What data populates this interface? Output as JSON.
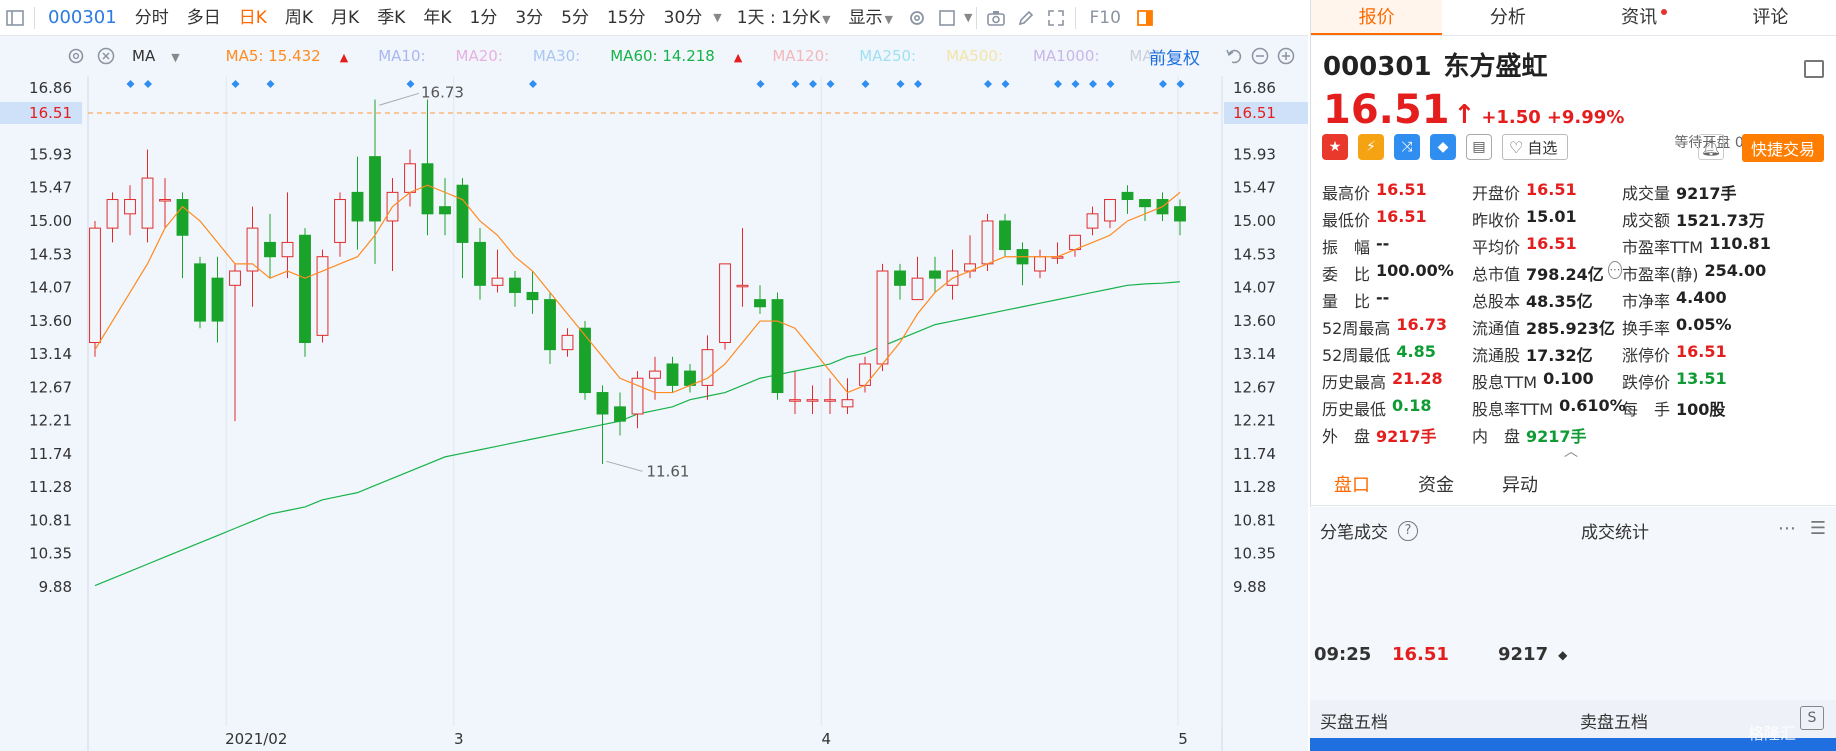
{
  "toolbar": {
    "code": "000301",
    "items": [
      "分时",
      "多日",
      "日K",
      "周K",
      "月K",
      "季K",
      "年K",
      "1分",
      "3分",
      "5分",
      "15分",
      "30分"
    ],
    "active": "日K",
    "period": "1天 : 1分K",
    "display": "显示",
    "f10": "F10"
  },
  "ma_bar": {
    "indicator": "MA",
    "items": [
      {
        "label": "MA5: 15.432",
        "color": "#ff8a1f",
        "arrow": "▲",
        "faded": false
      },
      {
        "label": "MA10:",
        "color": "#aab6f0",
        "faded": true
      },
      {
        "label": "MA20:",
        "color": "#e8b0e0",
        "faded": true
      },
      {
        "label": "MA30:",
        "color": "#a9c7f2",
        "faded": true
      },
      {
        "label": "MA60: 14.218",
        "color": "#17b24a",
        "arrow": "▲",
        "faded": false
      },
      {
        "label": "MA120:",
        "color": "#f4b6bd",
        "faded": true
      },
      {
        "label": "MA250:",
        "color": "#9fe0f4",
        "faded": true
      },
      {
        "label": "MA500:",
        "color": "#f3e4a7",
        "faded": true
      },
      {
        "label": "MA1000:",
        "color": "#c9b6e8",
        "faded": true
      },
      {
        "label": "MA1:",
        "color": "#c9d0dc",
        "faded": true
      }
    ],
    "restore": "前复权"
  },
  "chart_data": {
    "type": "candlestick",
    "y_ticks": [
      "16.86",
      "16.51",
      "15.93",
      "15.47",
      "15.00",
      "14.53",
      "14.07",
      "13.60",
      "13.14",
      "12.67",
      "12.21",
      "11.74",
      "11.28",
      "10.81",
      "10.35",
      "9.88"
    ],
    "x_ticks": [
      "2021/02",
      "3",
      "4",
      "5"
    ],
    "current_price": "16.51",
    "high_label": "16.73",
    "low_label": "11.61",
    "colors": {
      "up": "#e12b2b",
      "down": "#1aa32a",
      "ma5": "#ff8a1f",
      "ma60": "#17b24a",
      "current": "#ff9a3c"
    },
    "candles": [
      [
        13.3,
        14.9,
        13.1,
        15.0
      ],
      [
        14.9,
        15.3,
        14.7,
        15.4
      ],
      [
        15.1,
        15.3,
        14.8,
        15.5
      ],
      [
        14.9,
        15.6,
        14.7,
        16.0
      ],
      [
        15.3,
        15.3,
        14.9,
        15.6
      ],
      [
        15.3,
        14.8,
        14.2,
        15.4
      ],
      [
        14.4,
        13.6,
        13.5,
        14.5
      ],
      [
        14.2,
        13.6,
        13.3,
        14.5
      ],
      [
        14.1,
        14.3,
        12.2,
        14.4
      ],
      [
        14.3,
        14.9,
        13.8,
        15.2
      ],
      [
        14.7,
        14.5,
        14.2,
        15.1
      ],
      [
        14.5,
        14.7,
        14.2,
        15.4
      ],
      [
        14.8,
        13.3,
        13.1,
        14.9
      ],
      [
        13.4,
        14.5,
        13.3,
        14.6
      ],
      [
        14.7,
        15.3,
        14.5,
        15.4
      ],
      [
        15.4,
        15.0,
        14.6,
        15.9
      ],
      [
        15.9,
        15.0,
        14.4,
        16.7
      ],
      [
        15.0,
        15.4,
        14.3,
        15.6
      ],
      [
        15.4,
        15.8,
        15.2,
        16.0
      ],
      [
        15.8,
        15.1,
        14.8,
        16.7
      ],
      [
        15.2,
        15.1,
        14.8,
        15.6
      ],
      [
        15.5,
        14.7,
        14.2,
        15.6
      ],
      [
        14.7,
        14.1,
        13.9,
        14.9
      ],
      [
        14.1,
        14.2,
        14.0,
        14.6
      ],
      [
        14.2,
        14.0,
        13.8,
        14.3
      ],
      [
        14.0,
        13.9,
        13.7,
        14.3
      ],
      [
        13.9,
        13.2,
        13.0,
        14.0
      ],
      [
        13.2,
        13.4,
        13.1,
        13.5
      ],
      [
        13.5,
        12.6,
        12.5,
        13.6
      ],
      [
        12.6,
        12.3,
        11.6,
        12.7
      ],
      [
        12.4,
        12.2,
        12.0,
        12.6
      ],
      [
        12.3,
        12.8,
        12.1,
        12.9
      ],
      [
        12.8,
        12.9,
        12.5,
        13.1
      ],
      [
        13.0,
        12.7,
        12.6,
        13.1
      ],
      [
        12.9,
        12.7,
        12.6,
        13.0
      ],
      [
        12.7,
        13.2,
        12.5,
        13.4
      ],
      [
        13.3,
        14.4,
        13.2,
        14.4
      ],
      [
        14.1,
        14.1,
        13.8,
        14.9
      ],
      [
        13.9,
        13.8,
        13.7,
        14.1
      ],
      [
        13.9,
        12.6,
        12.5,
        14.0
      ],
      [
        12.5,
        12.5,
        12.3,
        12.9
      ],
      [
        12.5,
        12.5,
        12.3,
        12.7
      ],
      [
        12.5,
        12.5,
        12.3,
        12.8
      ],
      [
        12.4,
        12.5,
        12.3,
        12.8
      ],
      [
        12.7,
        13.0,
        12.6,
        13.1
      ],
      [
        13.0,
        14.3,
        12.9,
        14.4
      ],
      [
        14.3,
        14.1,
        13.9,
        14.4
      ],
      [
        13.9,
        14.2,
        13.9,
        14.5
      ],
      [
        14.3,
        14.2,
        14.0,
        14.5
      ],
      [
        14.1,
        14.3,
        13.9,
        14.6
      ],
      [
        14.3,
        14.4,
        14.2,
        14.8
      ],
      [
        14.4,
        15.0,
        14.3,
        15.1
      ],
      [
        15.0,
        14.6,
        14.5,
        15.1
      ],
      [
        14.6,
        14.4,
        14.1,
        14.7
      ],
      [
        14.3,
        14.5,
        14.2,
        14.6
      ],
      [
        14.5,
        14.5,
        14.4,
        14.7
      ],
      [
        14.6,
        14.8,
        14.5,
        14.8
      ],
      [
        14.9,
        15.1,
        14.8,
        15.2
      ],
      [
        15.0,
        15.3,
        14.9,
        15.3
      ],
      [
        15.4,
        15.3,
        15.1,
        15.5
      ],
      [
        15.3,
        15.2,
        15.0,
        15.3
      ],
      [
        15.3,
        15.1,
        15.0,
        15.4
      ],
      [
        15.2,
        15.0,
        14.8,
        15.3
      ]
    ],
    "ma5": [
      13.2,
      13.6,
      14.0,
      14.4,
      14.9,
      15.2,
      15.0,
      14.7,
      14.4,
      14.4,
      14.2,
      14.3,
      14.2,
      14.3,
      14.4,
      14.5,
      14.8,
      15.2,
      15.4,
      15.5,
      15.4,
      15.3,
      15.0,
      14.8,
      14.5,
      14.3,
      14.0,
      13.7,
      13.4,
      13.1,
      12.8,
      12.7,
      12.6,
      12.6,
      12.7,
      12.8,
      13.0,
      13.3,
      13.6,
      13.6,
      13.5,
      13.2,
      12.9,
      12.6,
      12.7,
      13.0,
      13.3,
      13.7,
      14.0,
      14.2,
      14.3,
      14.4,
      14.5,
      14.5,
      14.5,
      14.5,
      14.6,
      14.7,
      14.8,
      15.0,
      15.1,
      15.2,
      15.4
    ],
    "ma60": [
      9.9,
      10.0,
      10.1,
      10.2,
      10.3,
      10.4,
      10.5,
      10.6,
      10.7,
      10.8,
      10.9,
      10.95,
      11.0,
      11.1,
      11.15,
      11.2,
      11.3,
      11.4,
      11.5,
      11.6,
      11.7,
      11.75,
      11.8,
      11.85,
      11.9,
      11.95,
      12.0,
      12.05,
      12.1,
      12.15,
      12.2,
      12.3,
      12.35,
      12.4,
      12.5,
      12.55,
      12.6,
      12.7,
      12.8,
      12.85,
      12.9,
      12.95,
      13.0,
      13.1,
      13.15,
      13.25,
      13.35,
      13.45,
      13.55,
      13.6,
      13.65,
      13.7,
      13.75,
      13.8,
      13.85,
      13.9,
      13.95,
      14.0,
      14.05,
      14.1,
      14.12,
      14.13,
      14.15
    ]
  },
  "right_tabs": [
    "报价",
    "分析",
    "资讯",
    "评论"
  ],
  "stock": {
    "code": "000301",
    "name": "东方盛虹",
    "price": "16.51",
    "arrow": "↑",
    "change": "+1.50",
    "pct": "+9.99%",
    "status": "等待开盘 05/13 09:30",
    "fav": "自选",
    "quick_trade": "快捷交易"
  },
  "quote_rows": [
    [
      {
        "k": "最高价",
        "v": "16.51",
        "c": "red"
      },
      {
        "k": "开盘价",
        "v": "16.51",
        "c": "red"
      },
      {
        "k": "成交量",
        "v": "9217手",
        "c": "black"
      }
    ],
    [
      {
        "k": "最低价",
        "v": "16.51",
        "c": "red"
      },
      {
        "k": "昨收价",
        "v": "15.01",
        "c": "black"
      },
      {
        "k": "成交额",
        "v": "1521.73万",
        "c": "black"
      }
    ],
    [
      {
        "k": "振　幅",
        "v": "--",
        "c": "black"
      },
      {
        "k": "平均价",
        "v": "16.51",
        "c": "red"
      },
      {
        "k": "市盈率TTM",
        "v": "110.81",
        "c": "black"
      }
    ],
    [
      {
        "k": "委　比",
        "v": "100.00%",
        "c": "black"
      },
      {
        "k": "总市值",
        "v": "798.24亿",
        "c": "black"
      },
      {
        "k": "市盈率(静)",
        "v": "254.00",
        "c": "black"
      }
    ],
    [
      {
        "k": "量　比",
        "v": "--",
        "c": "black"
      },
      {
        "k": "总股本",
        "v": "48.35亿",
        "c": "black"
      },
      {
        "k": "市净率",
        "v": "4.400",
        "c": "black"
      }
    ],
    [
      {
        "k": "52周最高",
        "v": "16.73",
        "c": "red"
      },
      {
        "k": "流通值",
        "v": "285.923亿",
        "c": "black"
      },
      {
        "k": "换手率",
        "v": "0.05%",
        "c": "black"
      }
    ],
    [
      {
        "k": "52周最低",
        "v": "4.85",
        "c": "green"
      },
      {
        "k": "流通股",
        "v": "17.32亿",
        "c": "black"
      },
      {
        "k": "涨停价",
        "v": "16.51",
        "c": "red"
      }
    ],
    [
      {
        "k": "历史最高",
        "v": "21.28",
        "c": "red"
      },
      {
        "k": "股息TTM",
        "v": "0.100",
        "c": "black"
      },
      {
        "k": "跌停价",
        "v": "13.51",
        "c": "green"
      }
    ],
    [
      {
        "k": "历史最低",
        "v": "0.18",
        "c": "green"
      },
      {
        "k": "股息率TTM",
        "v": "0.610%",
        "c": "black"
      },
      {
        "k": "每　手",
        "v": "100股",
        "c": "black"
      }
    ],
    [
      {
        "k": "外　盘",
        "v": "9217手",
        "c": "red"
      },
      {
        "k": "内　盘",
        "v": "9217手",
        "c": "green"
      },
      null
    ]
  ],
  "sub_tabs": [
    "盘口",
    "资金",
    "异动"
  ],
  "tick": {
    "title": "分笔成交",
    "stats": "成交统计",
    "time": "09:25",
    "price": "16.51",
    "volume": "9217"
  },
  "book": {
    "buy": "买盘五档",
    "sell": "卖盘五档"
  },
  "watermark": "格隆汇"
}
